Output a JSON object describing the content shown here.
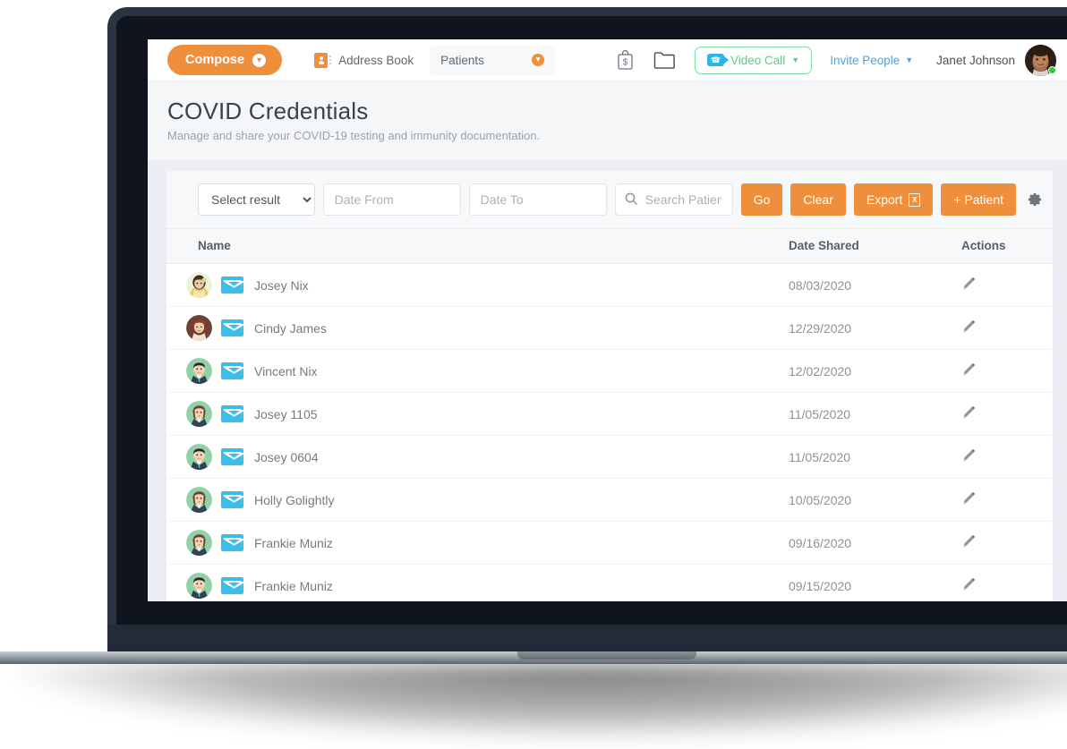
{
  "topnav": {
    "compose_label": "Compose",
    "address_book_label": "Address Book",
    "context_dropdown_value": "Patients",
    "video_call_label": "Video Call",
    "invite_people_label": "Invite People",
    "user_name": "Janet Johnson",
    "icons": [
      "billing-bag-icon",
      "folder-icon",
      "video-call-icon",
      "chevron-down-icon",
      "avatar"
    ]
  },
  "page": {
    "title": "COVID Credentials",
    "subtitle": "Manage and share your COVID-19 testing and immunity documentation."
  },
  "toolbar": {
    "result_select_value": "Select result",
    "result_select_options": [
      "Select result"
    ],
    "date_from_placeholder": "Date From",
    "date_from_value": "",
    "date_to_placeholder": "Date To",
    "date_to_value": "",
    "search_placeholder": "Search Patients",
    "search_value": "",
    "go_label": "Go",
    "clear_label": "Clear",
    "export_label": "Export",
    "export_badge": "X",
    "add_patient_label": "+ Patient",
    "settings_icon": "gear-icon"
  },
  "table": {
    "columns": [
      "Name",
      "Date Shared",
      "Actions"
    ],
    "rows": [
      {
        "name": "Josey Nix",
        "date": "08/03/2020",
        "avatar": "woman-yellow",
        "action": "edit-icon"
      },
      {
        "name": "Cindy James",
        "date": "12/29/2020",
        "avatar": "woman-red",
        "action": "edit-icon"
      },
      {
        "name": "Vincent Nix",
        "date": "12/02/2020",
        "avatar": "man-green",
        "action": "edit-icon"
      },
      {
        "name": "Josey 1105",
        "date": "11/05/2020",
        "avatar": "woman-green",
        "action": "edit-icon"
      },
      {
        "name": "Josey 0604",
        "date": "11/05/2020",
        "avatar": "man-green",
        "action": "edit-icon"
      },
      {
        "name": "Holly Golightly",
        "date": "10/05/2020",
        "avatar": "woman-green",
        "action": "edit-icon"
      },
      {
        "name": "Frankie Muniz",
        "date": "09/16/2020",
        "avatar": "woman-green",
        "action": "edit-icon"
      },
      {
        "name": "Frankie Muniz",
        "date": "09/15/2020",
        "avatar": "man-green",
        "action": "edit-icon"
      }
    ]
  },
  "colors": {
    "accent_orange": "#ef8f3c",
    "mail_blue": "#3cbdec",
    "video_green": "#5dc98d",
    "link_blue": "#4fa3e0",
    "online_green": "#2ecc40",
    "page_bg": "#eceef3",
    "bezel": "#2b3342"
  }
}
